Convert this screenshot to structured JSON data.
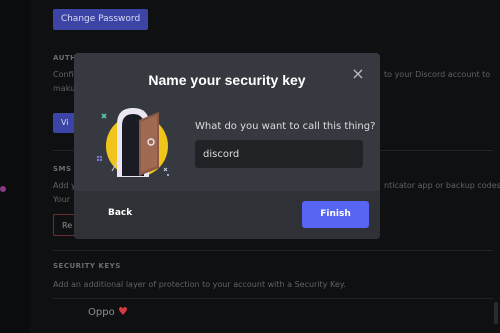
{
  "background": {
    "change_password_button": "Change Password",
    "auth_section_title": "AUTH",
    "auth_text_line1": "Confi",
    "auth_text_line1_right": "to your Discord account to",
    "auth_text_line2": "maku",
    "view_button": "Vi",
    "sms_section_title": "SMS",
    "sms_text_line1": "Add y",
    "sms_text_line1_right": "nticator app or backup codes",
    "sms_text_line2": "Your",
    "remove_button": "Re",
    "security_keys_title": "SECURITY KEYS",
    "security_keys_text": "Add an additional layer of protection to your account with a Security Key.",
    "key_name": "Oppo",
    "heart": "♥"
  },
  "modal": {
    "title": "Name your security key",
    "close_icon": "×",
    "question_label": "What do you want to call this thing?",
    "input_value": "discord",
    "back_label": "Back",
    "finish_label": "Finish"
  },
  "colors": {
    "accent": "#5865f2",
    "modal_bg": "#36393f",
    "footer_bg": "#2f3136",
    "input_bg": "#202225"
  }
}
